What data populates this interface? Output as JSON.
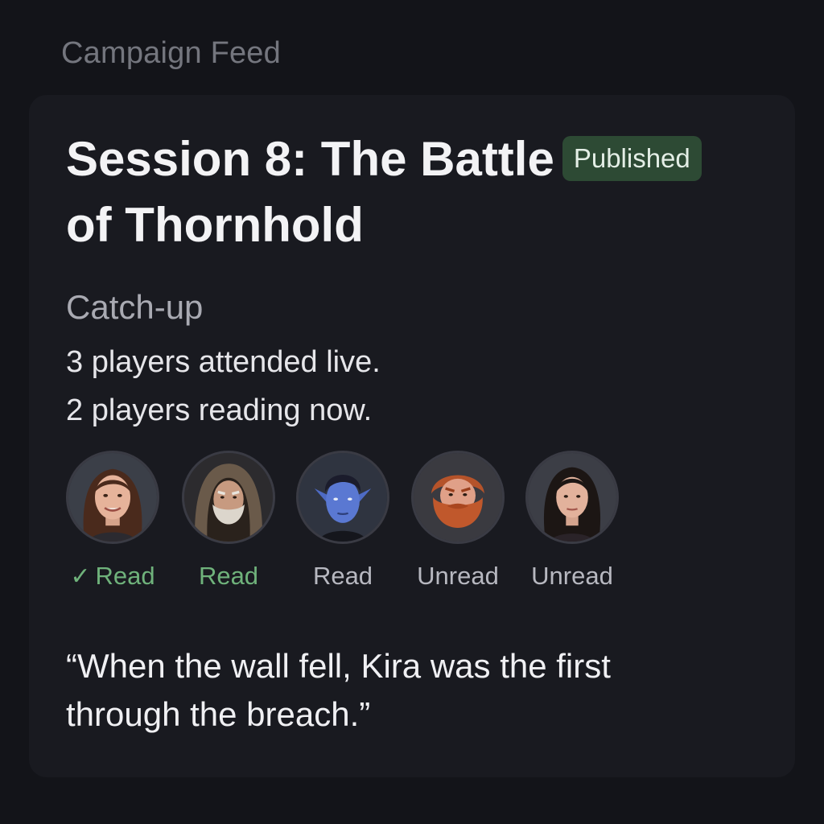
{
  "feed": {
    "title": "Campaign Feed"
  },
  "session": {
    "title_line1": "Session 8: The Battle",
    "title_line2": "of Thornhold",
    "badge": "Published"
  },
  "catchup": {
    "label": "Catch-up",
    "attended": "3 players attended live.",
    "reading": "2 players reading now."
  },
  "players": [
    {
      "avatar_icon": "woman-brown-hair-avatar",
      "status": "Read",
      "checked": true
    },
    {
      "avatar_icon": "hooded-old-man-avatar",
      "status": "Read",
      "checked": false
    },
    {
      "avatar_icon": "blue-elf-avatar",
      "status": "Read",
      "checked": false
    },
    {
      "avatar_icon": "red-bearded-dwarf-avatar",
      "status": "Unread",
      "checked": false
    },
    {
      "avatar_icon": "woman-dark-hair-avatar",
      "status": "Unread",
      "checked": false
    }
  ],
  "quote": {
    "line1": "“When the wall fell, Kira was the first",
    "line2": "through the breach.”"
  },
  "colors": {
    "background": "#131419",
    "card": "#191a20",
    "badge_bg": "#2d4a34",
    "read_green": "#6fb27b"
  }
}
